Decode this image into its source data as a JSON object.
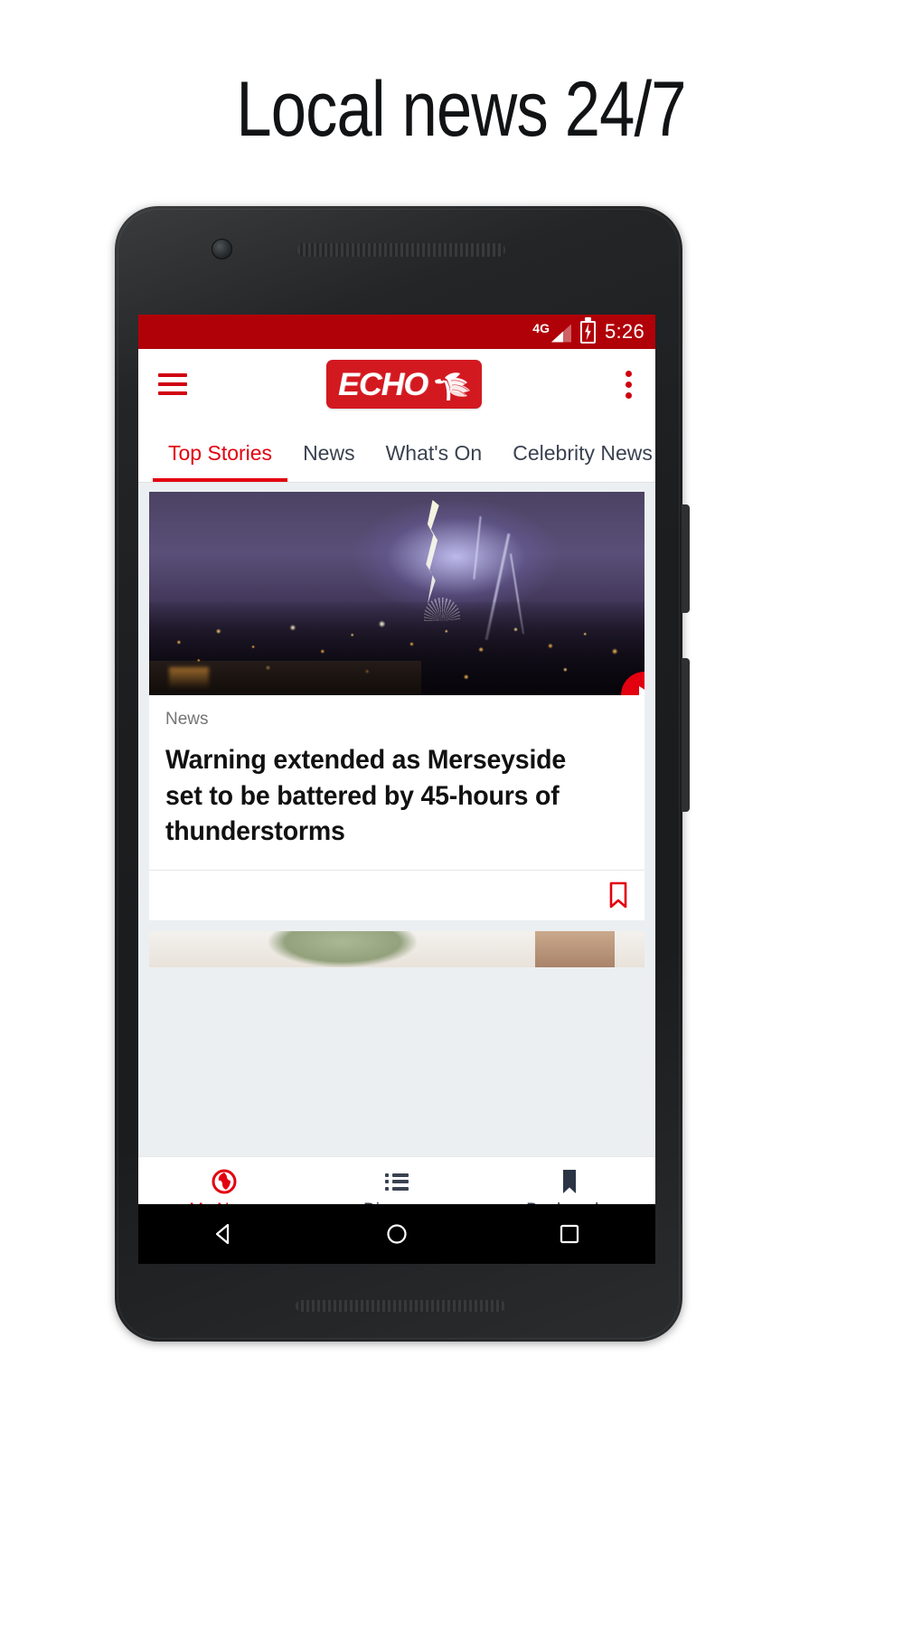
{
  "promo": {
    "headline": "Local news 24/7"
  },
  "statusbar": {
    "network_label": "4G",
    "signal_icon": "signal-bars-icon",
    "battery_icon": "battery-charging-icon",
    "time": "5:26",
    "bg_color": "#b00008"
  },
  "appbar": {
    "menu_icon": "hamburger-menu-icon",
    "logo_text": "ECHO",
    "logo_bird_icon": "liver-bird-icon",
    "overflow_icon": "kebab-menu-icon",
    "accent_color": "#d00010"
  },
  "tabs": {
    "items": [
      {
        "label": "Top Stories",
        "active": true
      },
      {
        "label": "News",
        "active": false
      },
      {
        "label": "What's On",
        "active": false
      },
      {
        "label": "Celebrity News",
        "active": false
      }
    ],
    "active_color": "#e3000f",
    "inactive_color": "#3a4250"
  },
  "article_card": {
    "image_alt": "lightning-over-city-photo",
    "play_icon": "play-button-icon",
    "category": "News",
    "title": "Warning extended as Merseyside set to be battered by 45-hours of thunderstorms",
    "bookmark_icon": "bookmark-outline-icon"
  },
  "bottom_nav": {
    "items": [
      {
        "label": "My News",
        "icon": "globe-icon",
        "active": true
      },
      {
        "label": "Discover",
        "icon": "list-icon",
        "active": false
      },
      {
        "label": "Bookmarks",
        "icon": "bookmark-filled-icon",
        "active": false
      }
    ],
    "active_color": "#e3000f"
  },
  "android_nav": {
    "back_icon": "back-triangle-icon",
    "home_icon": "home-circle-icon",
    "recents_icon": "recents-square-icon"
  }
}
